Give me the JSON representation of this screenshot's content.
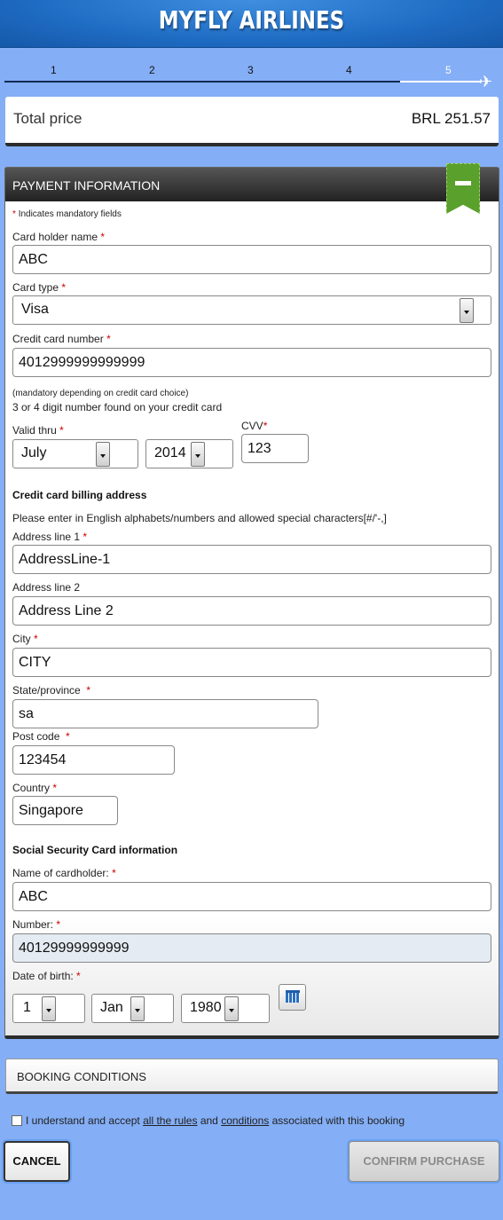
{
  "header": {
    "brand": "MYFLY AIRLINES"
  },
  "steps": [
    "1",
    "2",
    "3",
    "4",
    "5"
  ],
  "price": {
    "label": "Total price",
    "value": "BRL 251.57"
  },
  "payment": {
    "title": "PAYMENT INFORMATION",
    "mandatory_note": "Indicates mandatory fields",
    "req_mark": "*",
    "card_holder": {
      "label": "Card holder name",
      "value": "ABC"
    },
    "card_type": {
      "label": "Card type",
      "value": "Visa"
    },
    "card_number": {
      "label": "Credit card number",
      "value": "4012999999999999"
    },
    "cvv_hint1": "(mandatory depending on credit card choice)",
    "cvv_hint2": "3 or 4 digit number found on your credit card",
    "valid_thru": {
      "label": "Valid thru",
      "month": "July",
      "year": "2014"
    },
    "cvv": {
      "label": "CVV",
      "value": "123"
    },
    "billing": {
      "title": "Credit card billing address",
      "note": "Please enter in English alphabets/numbers and allowed special characters[#/'-,]",
      "addr1": {
        "label": "Address line 1",
        "value": "AddressLine-1"
      },
      "addr2": {
        "label": "Address line 2",
        "value": "Address Line 2"
      },
      "city": {
        "label": "City",
        "value": "CITY"
      },
      "state": {
        "label": "State/province",
        "value": "sa"
      },
      "postcode": {
        "label": "Post code",
        "value": "123454"
      },
      "country": {
        "label": "Country",
        "value": "Singapore"
      }
    },
    "ssn": {
      "title": "Social Security Card information",
      "name": {
        "label": "Name of cardholder:",
        "value": "ABC"
      },
      "number": {
        "label": "Number:",
        "value": "40129999999999"
      },
      "dob": {
        "label": "Date of birth:",
        "day": "1",
        "month": "Jan",
        "year": "1980"
      }
    }
  },
  "booking_conditions": "BOOKING CONDITIONS",
  "accept": {
    "prefix": "I understand and accept",
    "link1": "all the rules",
    "mid": "and",
    "link2": "conditions",
    "suffix": "associated with this booking"
  },
  "buttons": {
    "cancel": "CANCEL",
    "confirm": "CONFIRM PURCHASE"
  }
}
